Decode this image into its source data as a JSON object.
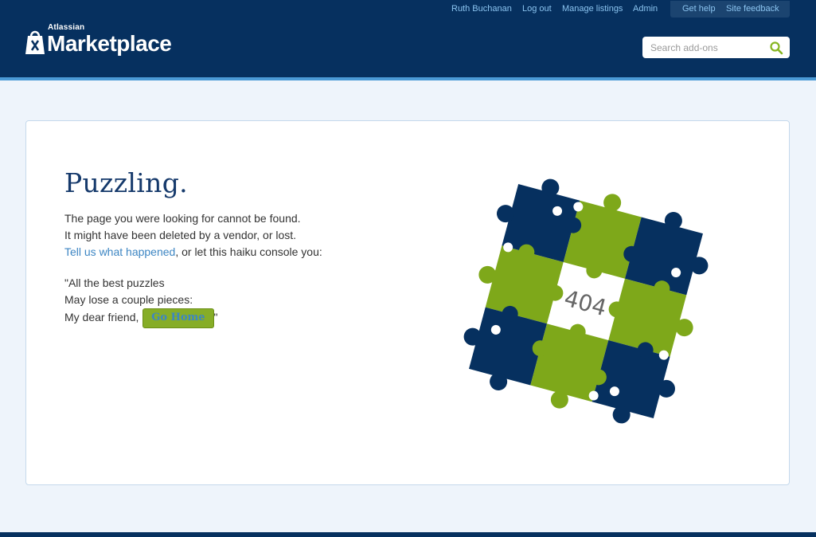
{
  "header": {
    "brand_small": "Atlassian",
    "brand_big": "Marketplace",
    "user_name": "Ruth Buchanan",
    "logout": "Log out",
    "manage_listings": "Manage listings",
    "admin": "Admin",
    "get_help": "Get help",
    "site_feedback": "Site feedback",
    "search_placeholder": "Search add-ons",
    "search_icon": "search-icon"
  },
  "main": {
    "title": "Puzzling.",
    "line1": "The page you were looking for cannot be found.",
    "line2": "It might have been deleted by a vendor, or lost.",
    "link_text": "Tell us what happened",
    "line3_rest": ", or let this haiku console you:",
    "haiku1": "\"All the best puzzles",
    "haiku2": "May lose a couple pieces:",
    "haiku3": "My dear friend, ",
    "go_home": "Go Home",
    "closing_quote": "\"",
    "puzzle_label": "404"
  },
  "colors": {
    "header_bg": "#06305f",
    "navy": "#06305f",
    "green": "#7ea81a",
    "link": "#3d86c3"
  }
}
